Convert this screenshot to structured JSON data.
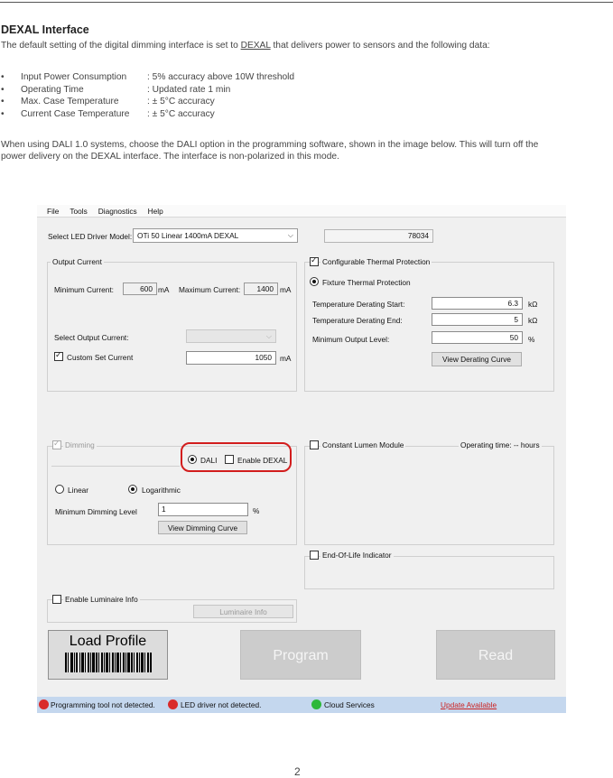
{
  "doc": {
    "title": "DEXAL Interface",
    "intro_before": "The default setting of the digital dimming interface is set to ",
    "intro_link": "DEXAL",
    "intro_after": " that delivers power to sensors and the following data:",
    "bullets": [
      {
        "label": "Input Power Consumption",
        "value": ":  5% accuracy above 10W threshold"
      },
      {
        "label": "Operating Time",
        "value": ":  Updated rate 1 min"
      },
      {
        "label": "Max. Case Temperature",
        "value": ":  ± 5°C accuracy"
      },
      {
        "label": "Current Case Temperature",
        "value": ":  ± 5°C accuracy"
      }
    ],
    "dali_line1": "When using DALI 1.0 systems, choose the DALI option in the programming software, shown in the image below. This will turn off the",
    "dali_line2": "power delivery on the DEXAL interface. The interface is non-polarized in this mode.",
    "page_number": "2"
  },
  "app": {
    "menu": [
      "File",
      "Tools",
      "Diagnostics",
      "Help"
    ],
    "model_label": "Select LED Driver Model:",
    "model_value": "OTi 50 Linear 1400mA DEXAL",
    "model_code": "78034",
    "output": {
      "title": "Output Current",
      "min_label": "Minimum Current:",
      "min_value": "600",
      "max_label": "Maximum Current:",
      "max_value": "1400",
      "unit": "mA",
      "select_label": "Select Output Current:",
      "custom_label": "Custom Set Current",
      "custom_value": "1050"
    },
    "thermal": {
      "title": "Configurable Thermal Protection",
      "fixture_label": "Fixture Thermal Protection",
      "start_label": "Temperature Derating Start:",
      "start_value": "6.3",
      "end_label": "Temperature Derating End:",
      "end_value": "5",
      "kohm": "kΩ",
      "min_level_label": "Minimum Output Level:",
      "min_level_value": "50",
      "percent": "%",
      "view_button": "View Derating Curve"
    },
    "dimming": {
      "title": "Dimming",
      "dali_label": "DALI",
      "dexal_label": "Enable DEXAL",
      "linear_label": "Linear",
      "log_label": "Logarithmic",
      "min_dim_label": "Minimum Dimming Level",
      "min_dim_value": "1",
      "percent": "%",
      "view_button": "View Dimming Curve"
    },
    "clm": {
      "title": "Constant Lumen Module",
      "operating_label": "Operating time:",
      "operating_value": "-- hours"
    },
    "eol": {
      "title": "End-Of-Life Indicator"
    },
    "luminaire": {
      "title": "Enable Luminaire Info",
      "button": "Luminaire Info"
    },
    "buttons": {
      "load": "Load Profile",
      "program": "Program",
      "read": "Read"
    },
    "status": {
      "tool": "Programming tool not detected.",
      "driver": "LED driver not detected.",
      "cloud": "Cloud Services",
      "update": "Update Available"
    },
    "colors": {
      "status_red": "#d92b2b",
      "status_green": "#2db83a",
      "update_link": "#cc2222",
      "highlight_ring": "#d21d1d"
    }
  }
}
